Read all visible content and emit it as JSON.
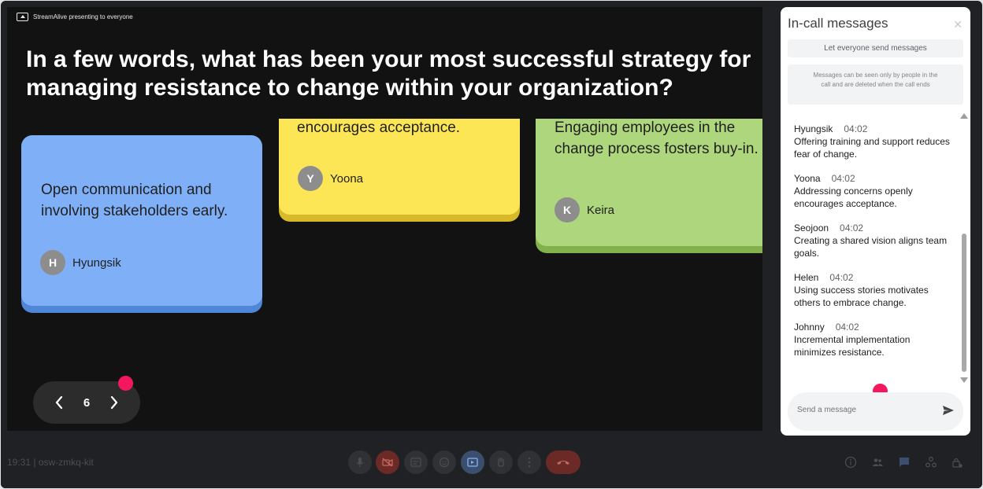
{
  "presenting_banner": "StreamAlive presenting to everyone",
  "question": "In a few words, what has been your most successful strategy for managing resistance to change within your organization?",
  "cards": [
    {
      "text": "Open communication and involving stakeholders early.",
      "initial": "H",
      "author": "Hyungsik"
    },
    {
      "text": "encourages acceptance.",
      "initial": "Y",
      "author": "Yoona"
    },
    {
      "text": "Engaging employees in the change process fosters buy-in.",
      "initial": "K",
      "author": "Keira"
    }
  ],
  "pager": {
    "current": "6"
  },
  "panel": {
    "title": "In-call messages",
    "let_everyone": "Let everyone send messages",
    "notice": "Messages can be seen only by people in the call and are deleted when the call ends",
    "send_placeholder": "Send a message",
    "messages": [
      {
        "name": "Hyungsik",
        "time": "04:02",
        "text": "Offering training and support reduces fear of change."
      },
      {
        "name": "Yoona",
        "time": "04:02",
        "text": "Addressing concerns openly encourages acceptance."
      },
      {
        "name": "Seojoon",
        "time": "04:02",
        "text": "Creating a shared vision aligns team goals."
      },
      {
        "name": "Helen",
        "time": "04:02",
        "text": "Using success stories motivates others to embrace change."
      },
      {
        "name": "Johnny",
        "time": "04:02",
        "text": "Incremental implementation minimizes resistance."
      }
    ]
  },
  "meeting": {
    "info": "19:31 | osw-zmkq-kit"
  },
  "colors": {
    "highlight_dot": "#f5175e",
    "end_call": "#ea4335",
    "card_blue": "#7fb0f7",
    "card_yellow": "#fde655",
    "card_green": "#aed67c"
  }
}
